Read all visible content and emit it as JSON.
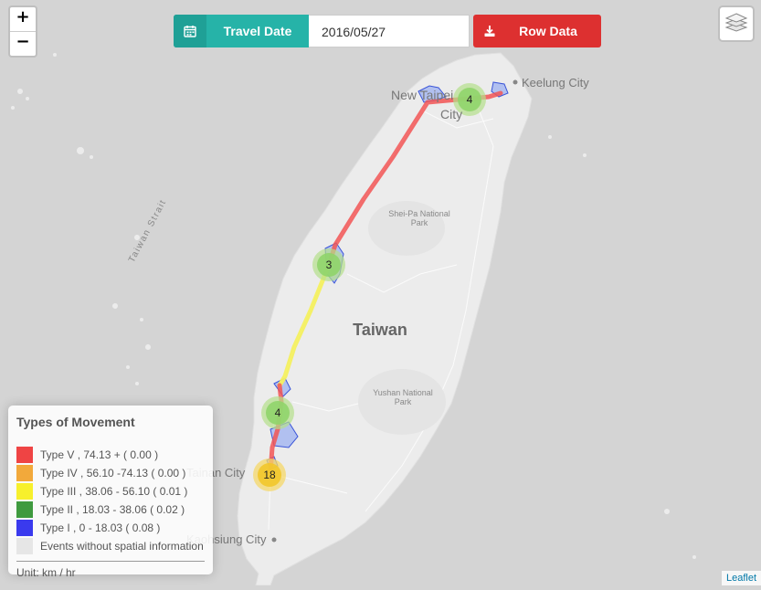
{
  "toolbar": {
    "travel_date_label": "Travel Date",
    "date_value": "2016/05/27",
    "row_data_label": "Row Data",
    "calendar_icon": "calendar-icon",
    "download_icon": "download-icon"
  },
  "zoom": {
    "in_label": "+",
    "out_label": "−"
  },
  "layers_icon": "layers-icon",
  "map": {
    "labels": {
      "taiwan": "Taiwan",
      "new_taipei_line1": "New Taipei",
      "new_taipei_line2": "City",
      "keelung": "Keelung City",
      "shei_pa_line1": "Shei-Pa National",
      "shei_pa_line2": "Park",
      "yushan_line1": "Yushan National",
      "yushan_line2": "Park",
      "tainan": "Tainan City",
      "kaohsiung": "Kaohsiung City",
      "taiwan_strait": "Taiwan Strait"
    },
    "clusters": [
      {
        "label": "4",
        "color": "#8fd46a"
      },
      {
        "label": "3",
        "color": "#8fd46a"
      },
      {
        "label": "4",
        "color": "#8fd46a"
      },
      {
        "label": "18",
        "color": "#f2c62a"
      }
    ],
    "route_colors": {
      "type_v": "#f25555",
      "type_iii": "#f4f060"
    }
  },
  "legend": {
    "title": "Types of Movement",
    "items": [
      {
        "color": "#ef4444",
        "label": "Type V , 74.13 + ( 0.00 )"
      },
      {
        "color": "#f2a93b",
        "label": "Type IV , 56.10 -74.13 ( 0.00 )"
      },
      {
        "color": "#f7f02c",
        "label": "Type III , 38.06 - 56.10 ( 0.01 )"
      },
      {
        "color": "#3f9a3f",
        "label": "Type II , 18.03 - 38.06 ( 0.02 )"
      },
      {
        "color": "#3a3aee",
        "label": "Type I , 0 - 18.03 ( 0.08 )"
      },
      {
        "color": "#e6e6e6",
        "label": "Events without spatial information"
      }
    ],
    "unit": "Unit: km / hr"
  },
  "attribution": "Leaflet"
}
